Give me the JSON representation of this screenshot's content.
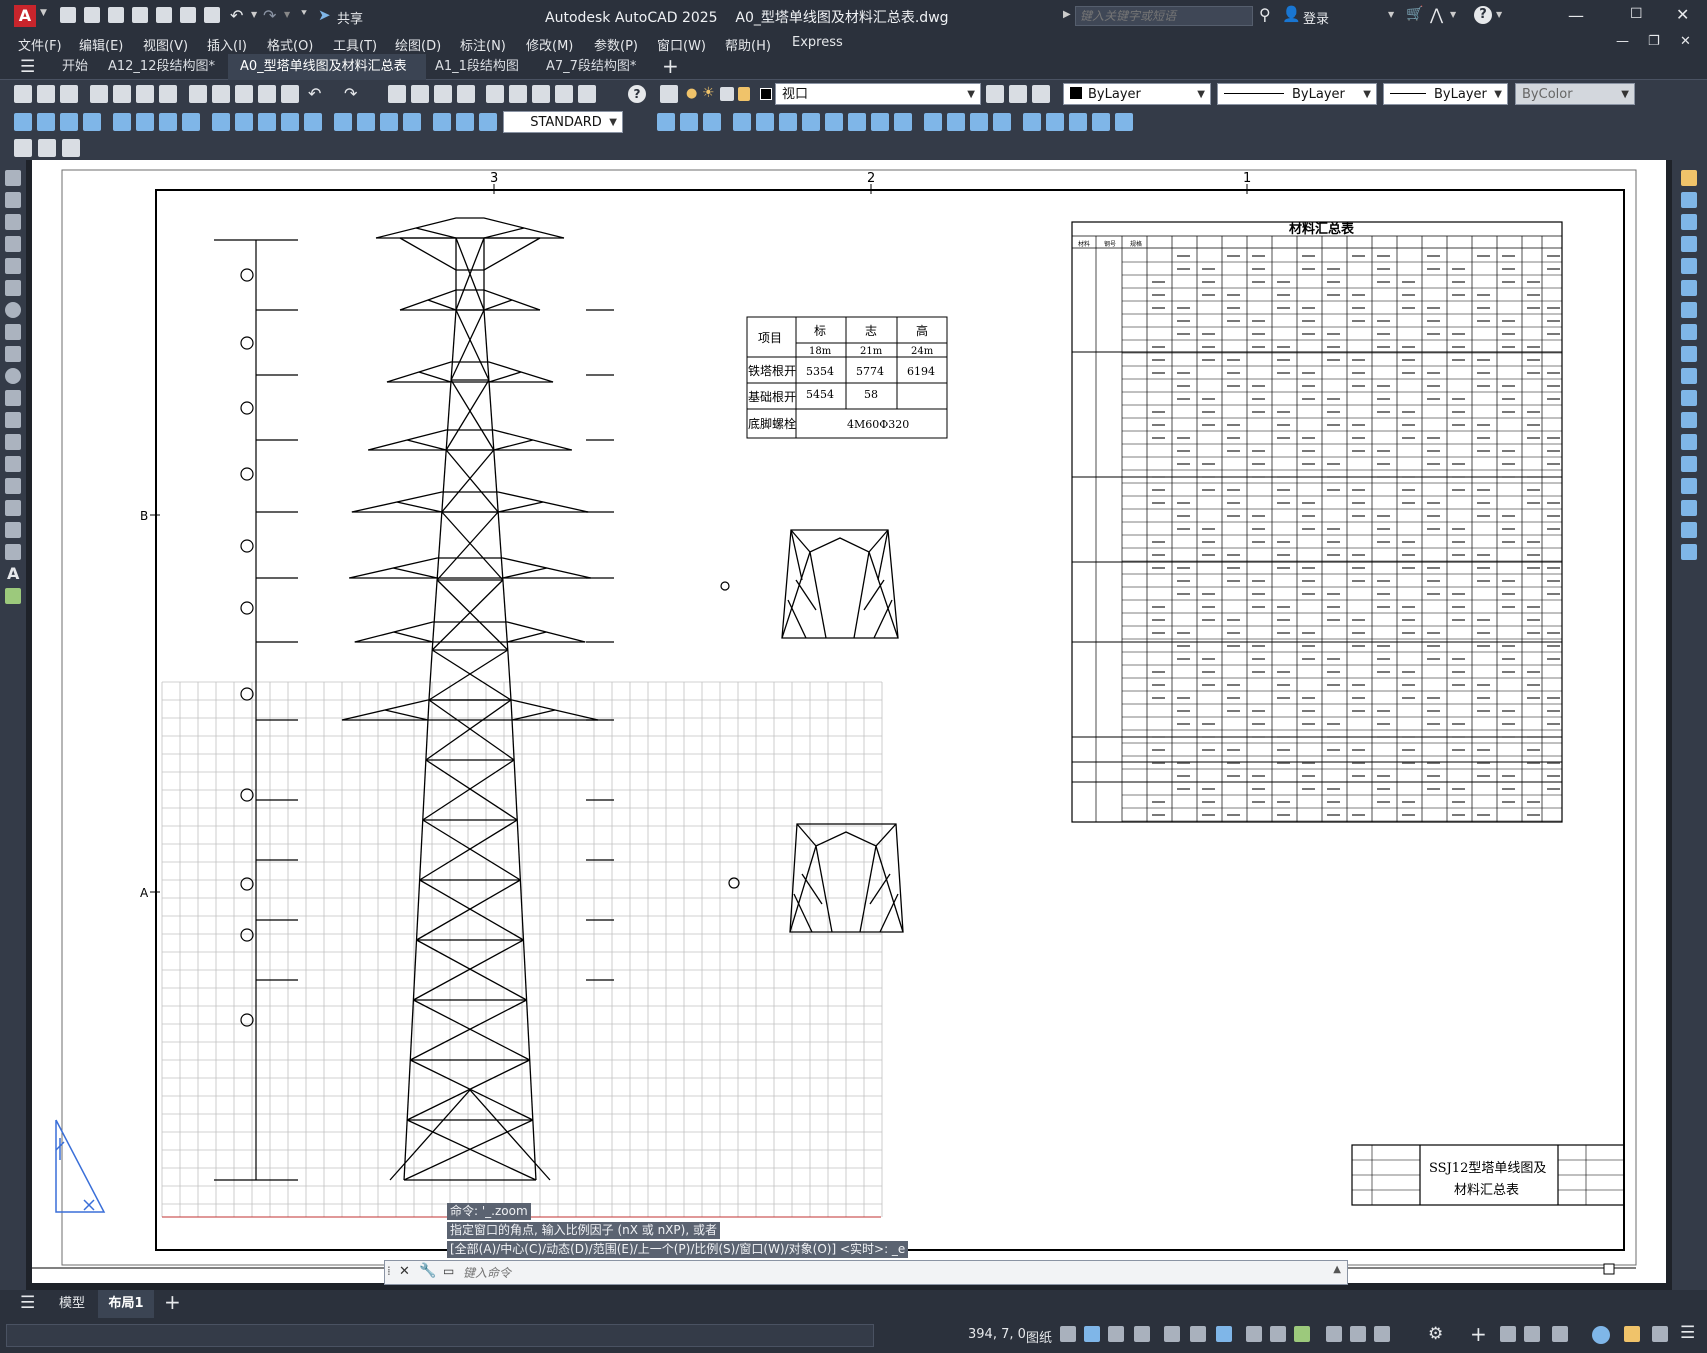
{
  "window": {
    "app_logo": "A",
    "title": "Autodesk AutoCAD 2025    A0_型塔单线图及材料汇总表.dwg",
    "share_label": "共享",
    "search_placeholder": "键入关键字或短语",
    "login_label": "登录"
  },
  "menu": [
    "文件(F)",
    "编辑(E)",
    "视图(V)",
    "插入(I)",
    "格式(O)",
    "工具(T)",
    "绘图(D)",
    "标注(N)",
    "修改(M)",
    "参数(P)",
    "窗口(W)",
    "帮助(H)",
    "Express"
  ],
  "tabs": [
    {
      "label": "开始"
    },
    {
      "label": "A12_12段结构图*"
    },
    {
      "label": "A0_型塔单线图及材料汇总表*",
      "active": true
    },
    {
      "label": "A1_1段结构图"
    },
    {
      "label": "A7_7段结构图*"
    }
  ],
  "toolbar": {
    "layer_value": "视口",
    "textstyle_value": "STANDARD",
    "color_value": "ByLayer",
    "linetype_value": "ByLayer",
    "lineweight_value": "ByLayer",
    "plotstyle_value": "ByColor"
  },
  "drawing": {
    "col_markers": [
      "3",
      "2",
      "1"
    ],
    "row_markers": [
      "B",
      "A"
    ],
    "spec_table": {
      "h_item": "项目",
      "h_group": [
        "标",
        "志",
        "高"
      ],
      "heights": [
        "18m",
        "21m",
        "24m"
      ],
      "rows": [
        {
          "label": "铁塔根开",
          "values": [
            "5354",
            "5774",
            "6194"
          ]
        },
        {
          "label": "基础根开",
          "values": [
            "5454",
            "58",
            ""
          ]
        },
        {
          "label": "底脚螺栓",
          "values": [
            "4M60Φ320"
          ]
        }
      ]
    },
    "material_table_title": "材料汇总表",
    "material_header": [
      "材料",
      "钢号",
      "规格"
    ],
    "title_block": [
      "SSJ12型塔单线图及",
      "材料汇总表"
    ]
  },
  "command": {
    "history": [
      "命令: '_.zoom",
      "指定窗口的角点, 输入比例因子 (nX 或 nXP), 或者",
      "[全部(A)/中心(C)/动态(D)/范围(E)/上一个(P)/比例(S)/窗口(W)/对象(O)] <实时>: _e"
    ],
    "input_placeholder": "键入命令"
  },
  "layout_tabs": [
    "模型",
    "布局1"
  ],
  "status": {
    "coords": "394, 7, 0",
    "paper_label": "图纸"
  }
}
